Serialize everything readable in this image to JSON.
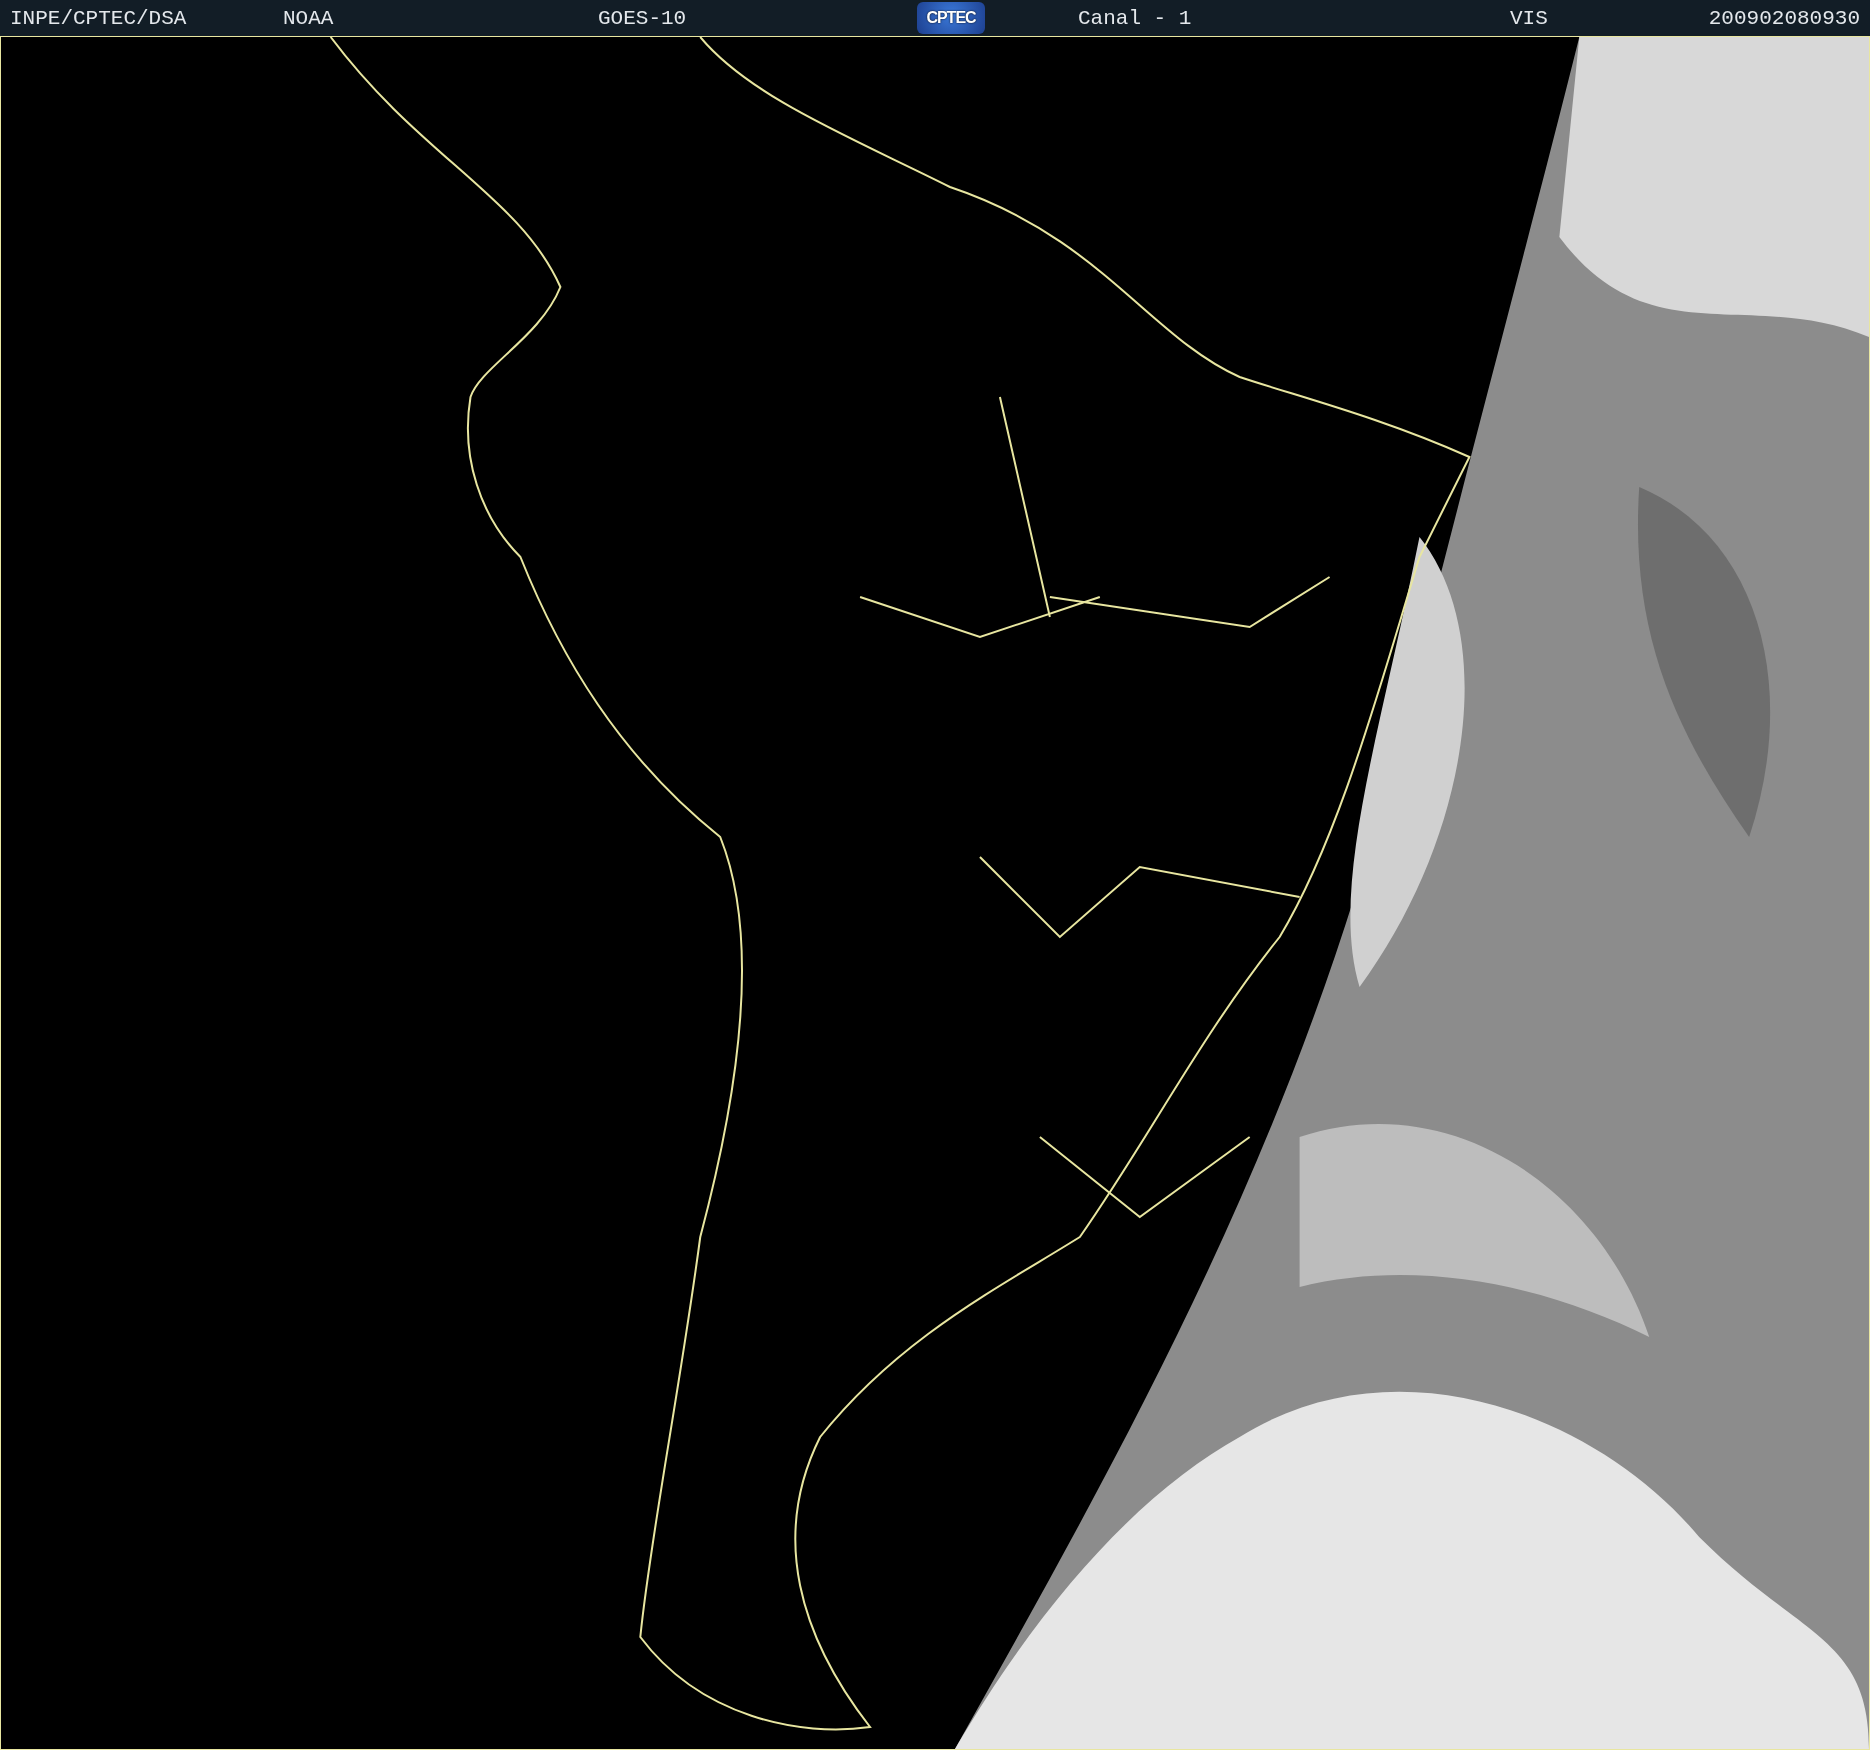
{
  "header": {
    "items": [
      {
        "kind": "text",
        "text": "INPE/CPTEC/DSA"
      },
      {
        "kind": "text",
        "text": "NOAA"
      },
      {
        "kind": "text",
        "text": "GOES-10"
      },
      {
        "kind": "logo",
        "text": "CPTEC"
      },
      {
        "kind": "text",
        "text": "Canal - 1"
      },
      {
        "kind": "text",
        "text": "VIS"
      },
      {
        "kind": "text",
        "text": "200902080930"
      }
    ]
  }
}
